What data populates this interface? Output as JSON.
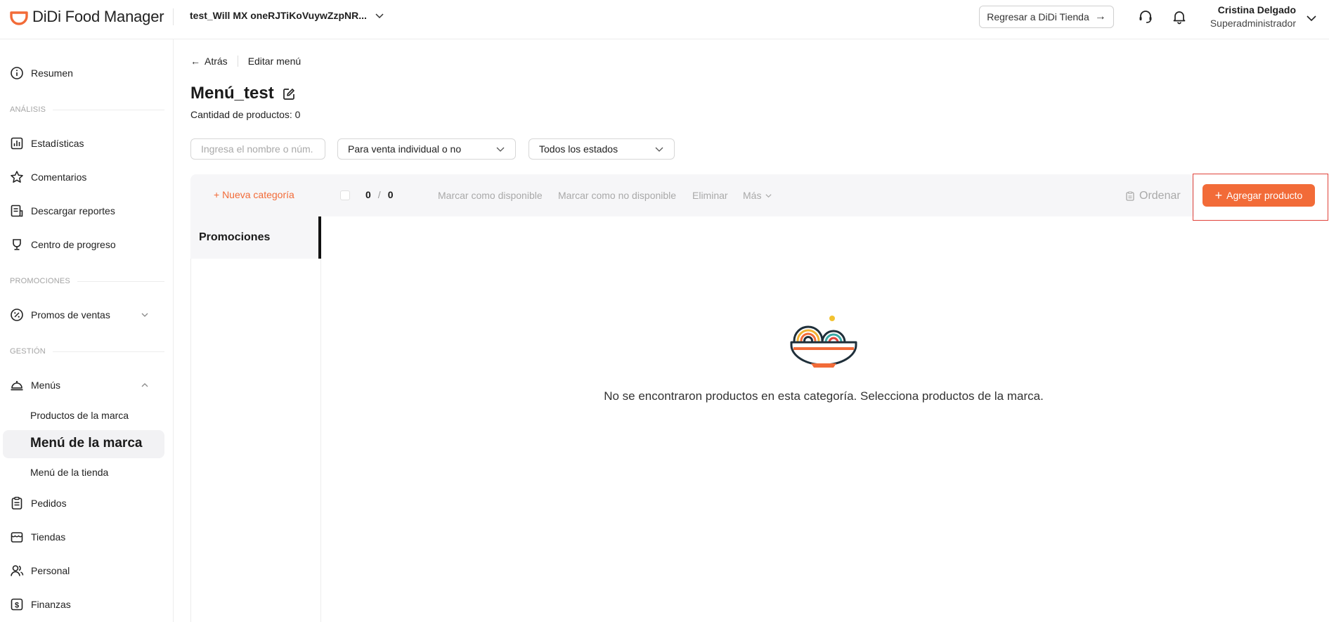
{
  "app": {
    "logo_text": "DiDi Food Manager",
    "store_name": "test_Will MX oneRJTiKoVuywZzpNR...",
    "return_label": "Regresar a DiDi Tienda",
    "user_name": "Cristina Delgado",
    "user_role": "Superadministrador"
  },
  "sidebar": {
    "resumen": "Resumen",
    "section_analisis": "ANÁLISIS",
    "estadisticas": "Estadísticas",
    "comentarios": "Comentarios",
    "descargar": "Descargar reportes",
    "progreso": "Centro de progreso",
    "section_promociones": "PROMOCIONES",
    "promos": "Promos de ventas",
    "section_gestion": "GESTIÓN",
    "menus": "Menús",
    "sub_productos": "Productos de la marca",
    "sub_menu_marca": "Menú de la marca",
    "sub_menu_tienda": "Menú de la tienda",
    "pedidos": "Pedidos",
    "tiendas": "Tiendas",
    "personal": "Personal",
    "finanzas": "Finanzas"
  },
  "main": {
    "back": "Atrás",
    "breadcrumb_current": "Editar menú",
    "title": "Menú_test",
    "count": "Cantidad de productos: 0",
    "search_placeholder": "Ingresa el nombre o núm. d",
    "filter_sale": "Para venta individual o no",
    "filter_status": "Todos los estados"
  },
  "toolbar": {
    "new_category": "+ Nueva categoría",
    "selected": "0",
    "total": "0",
    "mark_available": "Marcar como disponible",
    "mark_unavailable": "Marcar como no disponible",
    "delete": "Eliminar",
    "more": "Más",
    "sort": "Ordenar",
    "add_product": "Agregar producto"
  },
  "categories": [
    {
      "label": "Promociones"
    }
  ],
  "empty_state": {
    "message": "No se encontraron productos en esta categoría. Selecciona productos de la marca."
  },
  "colors": {
    "brand_orange": "#f26b38",
    "highlight_red": "#e0423a"
  }
}
